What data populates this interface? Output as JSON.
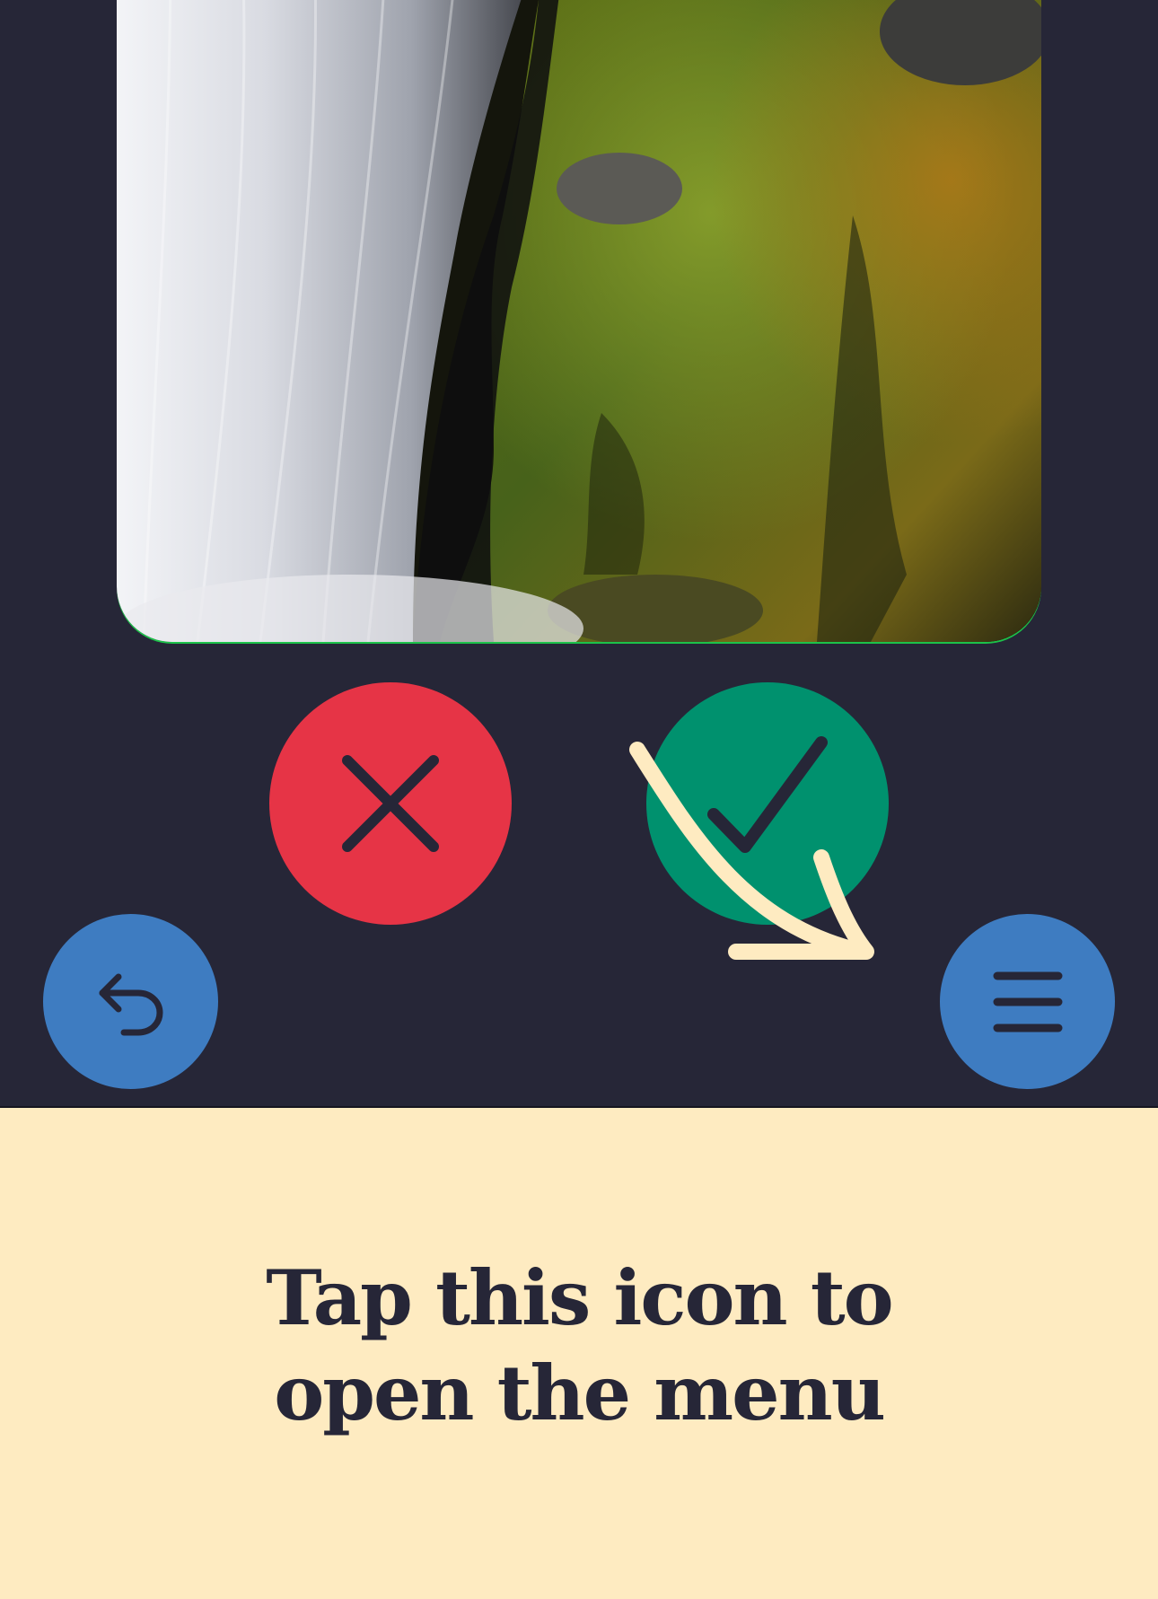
{
  "colors": {
    "background_dark": "#262637",
    "reject": "#e63446",
    "accept": "#00916e",
    "secondary": "#3e7cc1",
    "icon_stroke": "#262637",
    "highlight": "#feebc1",
    "tip_background": "#feebc1",
    "tip_text": "#262637"
  },
  "photo": {
    "subject": "waterfall beside moss-covered rock"
  },
  "buttons": {
    "reject_icon": "close-icon",
    "accept_icon": "checkmark-icon",
    "undo_icon": "undo-icon",
    "menu_icon": "hamburger-menu-icon"
  },
  "overlay": {
    "pointer_icon": "curved-arrow-icon"
  },
  "tip": {
    "line1": "Tap this icon to",
    "line2": "open the menu"
  }
}
